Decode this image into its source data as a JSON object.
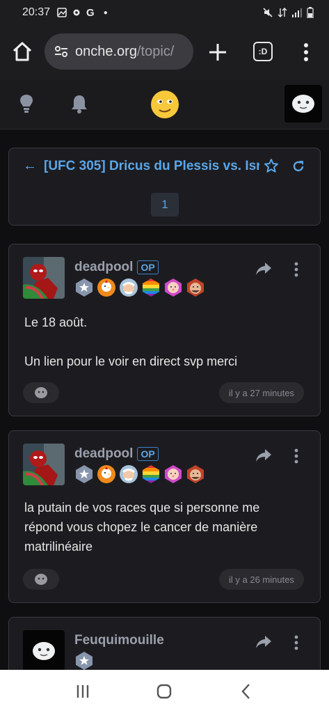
{
  "status_bar": {
    "time": "20:37",
    "left_icons": [
      "image-icon",
      "settings-icon",
      "google-icon",
      "dot-icon"
    ],
    "right_icons": [
      "mute-icon",
      "data-icon",
      "signal-icon",
      "battery-icon"
    ]
  },
  "browser": {
    "url_host": "onche.org",
    "url_path": "/topic/",
    "tabs_label": ":D"
  },
  "topic": {
    "title": "[UFC 305] Dricus du Plessis vs. Isr",
    "current_page": "1"
  },
  "posts": [
    {
      "username": "deadpool",
      "op_label": "OP",
      "body_lines": [
        "Le 18 août.",
        "",
        "Un lien pour le voir en direct svp merci"
      ],
      "time": "il y a 27 minutes"
    },
    {
      "username": "deadpool",
      "op_label": "OP",
      "body_lines": [
        "la putain de vos races que si personne me",
        "répond vous chopez le cancer de manière",
        "matrilinéaire"
      ],
      "time": "il y a 26 minutes"
    },
    {
      "username": "Feuquimouille"
    }
  ],
  "colors": {
    "accent": "#5aa6e8",
    "background": "#0f0f11",
    "card": "#1c1c20",
    "muted": "#9aa0ac"
  }
}
